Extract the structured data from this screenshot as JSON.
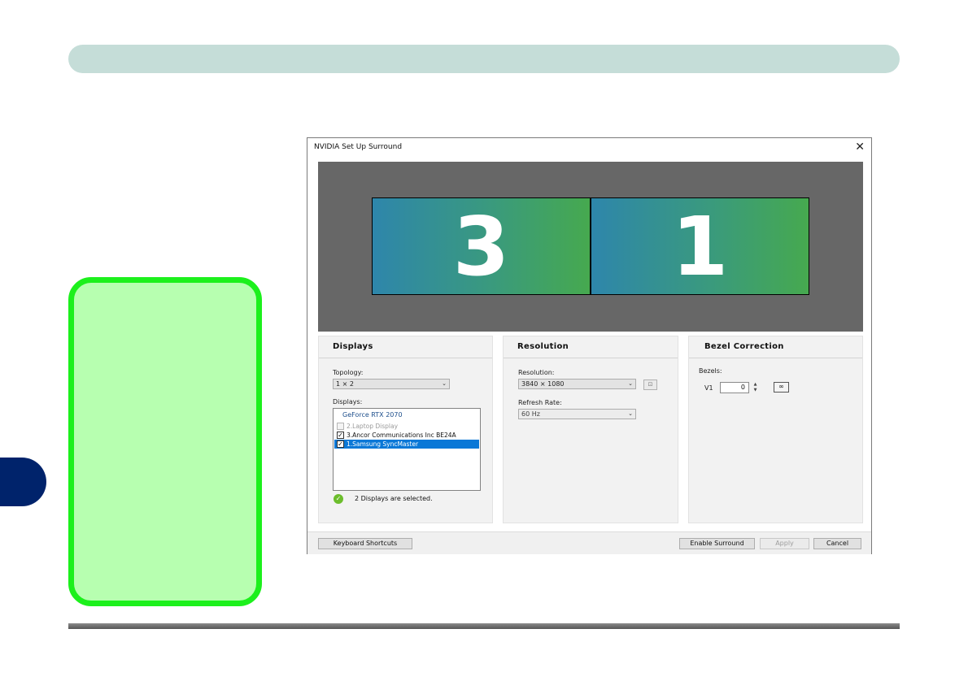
{
  "dialog": {
    "title": "NVIDIA Set Up Surround",
    "close_glyph": "✕"
  },
  "preview": {
    "monitors": [
      "3",
      "1"
    ]
  },
  "displays_panel": {
    "title": "Displays",
    "topology_label": "Topology:",
    "topology_value": "1 × 2",
    "displays_label": "Displays:",
    "gpu_name": "GeForce RTX 2070",
    "items": [
      {
        "label": "2.Laptop Display",
        "checked": false,
        "enabled": false,
        "selected": false
      },
      {
        "label": "3.Ancor Communications Inc BE24A",
        "checked": true,
        "enabled": true,
        "selected": false
      },
      {
        "label": "1.Samsung SyncMaster",
        "checked": true,
        "enabled": true,
        "selected": true
      }
    ],
    "status_text": "2 Displays are selected.",
    "status_icon": "check-circle-icon"
  },
  "resolution_panel": {
    "title": "Resolution",
    "resolution_label": "Resolution:",
    "resolution_value": "3840 × 1080",
    "refresh_label": "Refresh Rate:",
    "refresh_value": "60 Hz"
  },
  "bezel_panel": {
    "title": "Bezel Correction",
    "bezels_label": "Bezels:",
    "v1_label": "V1",
    "v1_value": "0"
  },
  "buttons": {
    "keyboard_shortcuts": "Keyboard Shortcuts",
    "enable_surround": "Enable Surround",
    "apply": "Apply",
    "cancel": "Cancel"
  },
  "colors": {
    "header_bar": "#c5ddd8",
    "side_tab": "#00236b",
    "note_box_fill": "#b7ffb0",
    "note_box_border": "#1cf01c",
    "selection": "#0a78d7"
  }
}
